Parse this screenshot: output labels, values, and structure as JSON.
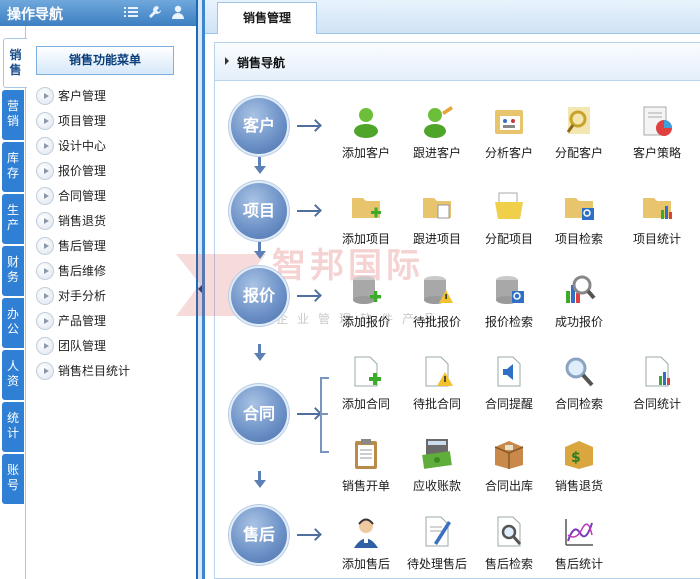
{
  "nav": {
    "title": "操作导航",
    "header_icons": [
      "list-icon",
      "wrench-icon",
      "user-icon"
    ],
    "vertical_tabs": [
      "销售",
      "营销",
      "库存",
      "生产",
      "财务",
      "办公",
      "人资",
      "统计",
      "账号"
    ],
    "menu_title": "销售功能菜单",
    "menu_items": [
      "客户管理",
      "项目管理",
      "设计中心",
      "报价管理",
      "合同管理",
      "销售退货",
      "售后管理",
      "售后维修",
      "对手分析",
      "产品管理",
      "团队管理",
      "销售栏目统计"
    ]
  },
  "main": {
    "tab": "销售管理",
    "panel_title": "销售导航",
    "watermark": {
      "title": "智邦国际",
      "subtitle": "企业管理软件产品"
    },
    "categories": [
      {
        "label": "客户",
        "actions": [
          "添加客户",
          "跟进客户",
          "分析客户",
          "分配客户",
          "客户策略"
        ]
      },
      {
        "label": "项目",
        "actions": [
          "添加项目",
          "跟进项目",
          "分配项目",
          "项目检索",
          "项目统计"
        ]
      },
      {
        "label": "报价",
        "actions": [
          "添加报价",
          "待批报价",
          "报价检索",
          "成功报价"
        ]
      },
      {
        "label": "合同",
        "actions": [
          "添加合同",
          "待批合同",
          "合同提醒",
          "合同检索",
          "合同统计",
          "销售开单",
          "应收账款",
          "合同出库",
          "销售退货"
        ]
      },
      {
        "label": "售后",
        "actions": [
          "添加售后",
          "待处理售后",
          "售后检索",
          "售后统计"
        ]
      }
    ]
  },
  "colors": {
    "accent": "#2f7fd4",
    "circle": "#6e93c8",
    "header": "#3d7fc1"
  }
}
